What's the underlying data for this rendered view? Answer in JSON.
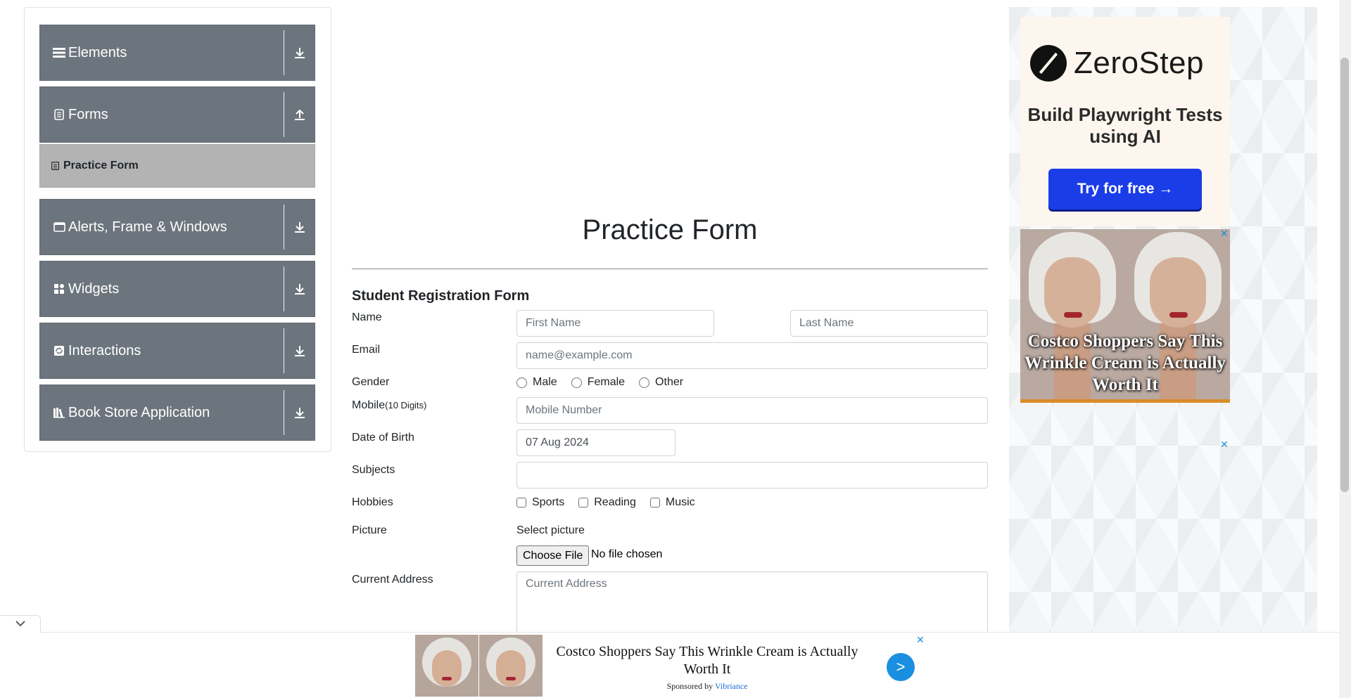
{
  "sidebar": {
    "groups": [
      {
        "label": "Elements",
        "icon": "hamburger-icon",
        "toggle": "download-icon"
      },
      {
        "label": "Forms",
        "icon": "document-icon",
        "toggle": "upload-icon"
      },
      {
        "label": "Alerts, Frame & Windows",
        "icon": "window-icon",
        "toggle": "download-icon"
      },
      {
        "label": "Widgets",
        "icon": "widgets-icon",
        "toggle": "download-icon"
      },
      {
        "label": "Interactions",
        "icon": "interactions-icon",
        "toggle": "download-icon"
      },
      {
        "label": "Book Store Application",
        "icon": "books-icon",
        "toggle": "download-icon"
      }
    ],
    "active_item": {
      "label": "Practice Form",
      "icon": "form-icon"
    }
  },
  "main": {
    "page_title": "Practice Form",
    "form_title": "Student Registration Form",
    "labels": {
      "name": "Name",
      "email": "Email",
      "gender": "Gender",
      "mobile": "Mobile",
      "mobile_hint": "(10 Digits)",
      "dob": "Date of Birth",
      "subjects": "Subjects",
      "hobbies": "Hobbies",
      "picture": "Picture",
      "address": "Current Address"
    },
    "placeholders": {
      "first_name": "First Name",
      "last_name": "Last Name",
      "email": "name@example.com",
      "mobile": "Mobile Number",
      "address": "Current Address"
    },
    "values": {
      "dob": "07 Aug 2024",
      "subjects": ""
    },
    "gender_options": [
      "Male",
      "Female",
      "Other"
    ],
    "hobby_options": [
      "Sports",
      "Reading",
      "Music"
    ],
    "picture_prompt": "Select picture",
    "file_button": "Choose File",
    "file_status": "No file chosen"
  },
  "ads": {
    "zerostep": {
      "brand": "ZeroStep",
      "tagline": "Build Playwright Tests using AI",
      "cta": "Try for free →",
      "cta_color": "#1a3de8"
    },
    "costco": {
      "headline": "Costco Shoppers Say This Wrinkle Cream is Actually Worth It",
      "close": "✕"
    },
    "empty_close": "✕",
    "bottom": {
      "headline": "Costco Shoppers Say This Wrinkle Cream is Actually Worth It",
      "sponsor_prefix": "Sponsored by ",
      "sponsor_name": "Vibriance",
      "go": ">",
      "close": "✕"
    }
  },
  "colors": {
    "sidebar_group": "#6c757d",
    "active_item": "#b3b3b3",
    "accent_blue": "#1a8fe0"
  }
}
